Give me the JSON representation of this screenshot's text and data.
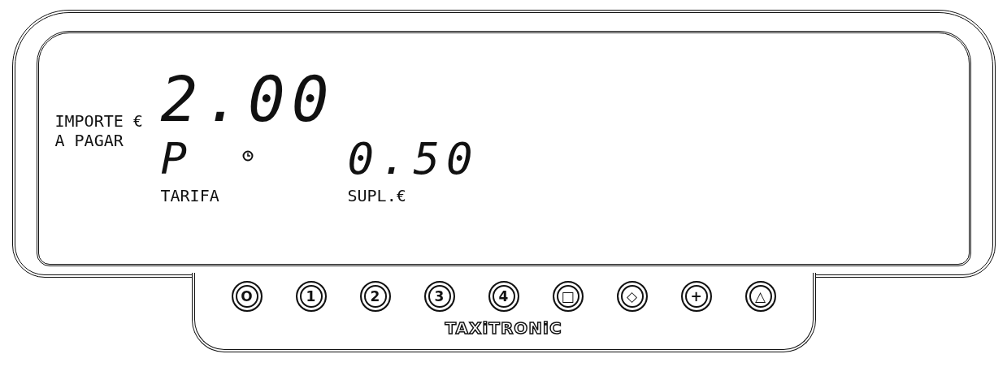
{
  "display": {
    "amount_label": "IMPORTE €",
    "amount_label_2": "A PAGAR",
    "amount": "2.00",
    "tariff": "P",
    "tariff_label": "TARIFA",
    "supplement": "0.50",
    "supplement_label": "SUPL.€",
    "clock_on": true
  },
  "buttons": [
    {
      "label": "O"
    },
    {
      "label": "1"
    },
    {
      "label": "2"
    },
    {
      "label": "3"
    },
    {
      "label": "4"
    },
    {
      "label": "□"
    },
    {
      "label": "◇"
    },
    {
      "label": "+"
    },
    {
      "label": "△"
    }
  ],
  "brand": "TAXiTRONiC"
}
